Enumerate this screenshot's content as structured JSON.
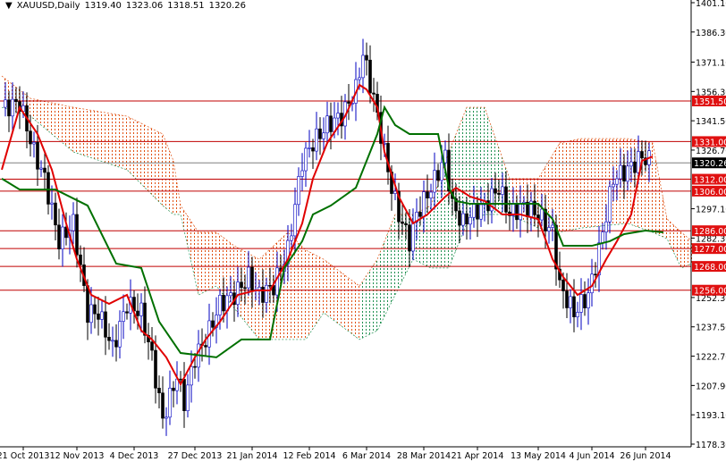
{
  "title": {
    "symbol": "XAUUSD,Daily",
    "open": "1319.40",
    "high": "1323.06",
    "low": "1318.51",
    "close": "1320.26"
  },
  "colors": {
    "bull": "#0000c0",
    "bear": "#000000",
    "tenkan": "#e00000",
    "kijun": "#007000",
    "cloud_bear": "#e05010",
    "cloud_bull": "#209050",
    "level": "#c00000",
    "current": "#808080"
  },
  "chart_data": {
    "type": "line",
    "title": "XAUUSD,Daily",
    "ylim": [
      1178.3,
      1401.1
    ],
    "y_ticks": [
      "1401.10",
      "1386.30",
      "1371.10",
      "1356.30",
      "1341.50",
      "1326.70",
      "1297.10",
      "1282.30",
      "1252.30",
      "1237.50",
      "1222.70",
      "1207.90",
      "1193.10",
      "1178.30"
    ],
    "x_ticks": [
      {
        "bar": 6,
        "label": "21 Oct 2013"
      },
      {
        "bar": 21,
        "label": "12 Nov 2013"
      },
      {
        "bar": 37,
        "label": "4 Dec 2013"
      },
      {
        "bar": 54,
        "label": "27 Dec 2013"
      },
      {
        "bar": 70,
        "label": "21 Jan 2014"
      },
      {
        "bar": 86,
        "label": "12 Feb 2014"
      },
      {
        "bar": 102,
        "label": "6 Mar 2014"
      },
      {
        "bar": 118,
        "label": "28 Mar 2014"
      },
      {
        "bar": 133,
        "label": "21 Apr 2014"
      },
      {
        "bar": 150,
        "label": "13 May 2014"
      },
      {
        "bar": 165,
        "label": "4 Jun 2014"
      },
      {
        "bar": 180,
        "label": "26 Jun 2014"
      }
    ],
    "levels": [
      "1351.50",
      "1331.00",
      "1312.00",
      "1306.00",
      "1286.00",
      "1277.00",
      "1268.00",
      "1256.00"
    ],
    "current_price": "1320.26",
    "closes": [
      [
        1,
        1348.3
      ],
      [
        5,
        1350.6
      ],
      [
        9,
        1325.8
      ],
      [
        12,
        1312.3
      ],
      [
        16,
        1280.7
      ],
      [
        20,
        1289.7
      ],
      [
        24,
        1244.6
      ],
      [
        27,
        1244.6
      ],
      [
        31,
        1226.6
      ],
      [
        35,
        1249.1
      ],
      [
        39,
        1244.6
      ],
      [
        42,
        1222.1
      ],
      [
        45,
        1190.5
      ],
      [
        49,
        1213.1
      ],
      [
        51,
        1199.5
      ],
      [
        54,
        1222.1
      ],
      [
        57,
        1231.1
      ],
      [
        61,
        1249.1
      ],
      [
        65,
        1253.6
      ],
      [
        69,
        1262.6
      ],
      [
        72,
        1253.6
      ],
      [
        76,
        1258.1
      ],
      [
        80,
        1276.2
      ],
      [
        84,
        1321.3
      ],
      [
        87,
        1330.3
      ],
      [
        91,
        1339.3
      ],
      [
        95,
        1343.8
      ],
      [
        99,
        1357.3
      ],
      [
        101,
        1375.4
      ],
      [
        104,
        1352.8
      ],
      [
        106,
        1334.8
      ],
      [
        109,
        1307.7
      ],
      [
        111,
        1294.2
      ],
      [
        114,
        1280.7
      ],
      [
        116,
        1294.2
      ],
      [
        120,
        1307.7
      ],
      [
        124,
        1323.5
      ],
      [
        126,
        1298.7
      ],
      [
        129,
        1289.7
      ],
      [
        131,
        1294.2
      ],
      [
        135,
        1298.7
      ],
      [
        139,
        1307.7
      ],
      [
        142,
        1294.2
      ],
      [
        146,
        1298.7
      ],
      [
        150,
        1294.2
      ],
      [
        154,
        1285.2
      ],
      [
        156,
        1258.1
      ],
      [
        160,
        1244.6
      ],
      [
        164,
        1253.6
      ],
      [
        167,
        1276.2
      ],
      [
        171,
        1312.3
      ],
      [
        175,
        1316.8
      ],
      [
        179,
        1323.5
      ],
      [
        182,
        1320.3
      ]
    ],
    "series": [
      {
        "name": "Tenkan-sen",
        "values": [
          [
            0,
            1316.8
          ],
          [
            5,
            1348.3
          ],
          [
            10,
            1334.8
          ],
          [
            14,
            1316.8
          ],
          [
            18,
            1289.7
          ],
          [
            21,
            1271.6
          ],
          [
            25,
            1253.6
          ],
          [
            30,
            1249.1
          ],
          [
            35,
            1253.6
          ],
          [
            39,
            1235.6
          ],
          [
            42,
            1231.1
          ],
          [
            46,
            1222.1
          ],
          [
            50,
            1208.5
          ],
          [
            54,
            1222.1
          ],
          [
            57,
            1231.1
          ],
          [
            61,
            1240.1
          ],
          [
            66,
            1253.6
          ],
          [
            71,
            1255.9
          ],
          [
            75,
            1255.9
          ],
          [
            80,
            1271.6
          ],
          [
            84,
            1289.7
          ],
          [
            87,
            1312.3
          ],
          [
            91,
            1330.3
          ],
          [
            96,
            1343.8
          ],
          [
            100,
            1359.6
          ],
          [
            102,
            1357.3
          ],
          [
            105,
            1348.3
          ],
          [
            107,
            1325.8
          ],
          [
            111,
            1303.2
          ],
          [
            115,
            1289.7
          ],
          [
            119,
            1294.2
          ],
          [
            124,
            1303.2
          ],
          [
            127,
            1307.7
          ],
          [
            131,
            1303.2
          ],
          [
            135,
            1301.0
          ],
          [
            140,
            1294.2
          ],
          [
            145,
            1294.2
          ],
          [
            150,
            1291.9
          ],
          [
            154,
            1271.6
          ],
          [
            157,
            1262.6
          ],
          [
            161,
            1253.6
          ],
          [
            165,
            1258.1
          ],
          [
            169,
            1271.6
          ],
          [
            172,
            1280.7
          ],
          [
            176,
            1294.2
          ],
          [
            179,
            1321.3
          ],
          [
            182,
            1323.5
          ]
        ]
      },
      {
        "name": "Kijun-sen",
        "values": [
          [
            0,
            1312.3
          ],
          [
            5,
            1306.8
          ],
          [
            15,
            1306.8
          ],
          [
            24,
            1298.7
          ],
          [
            32,
            1269.4
          ],
          [
            39,
            1267.2
          ],
          [
            44,
            1240.1
          ],
          [
            50,
            1224.3
          ],
          [
            60,
            1222.1
          ],
          [
            67,
            1231.1
          ],
          [
            75,
            1231.1
          ],
          [
            79,
            1267.2
          ],
          [
            84,
            1280.7
          ],
          [
            87,
            1294.2
          ],
          [
            92,
            1298.7
          ],
          [
            99,
            1307.7
          ],
          [
            105,
            1334.8
          ],
          [
            107,
            1348.3
          ],
          [
            110,
            1339.3
          ],
          [
            114,
            1334.8
          ],
          [
            122,
            1334.8
          ],
          [
            125,
            1307.7
          ],
          [
            127,
            1301.0
          ],
          [
            131,
            1299.6
          ],
          [
            150,
            1299.6
          ],
          [
            154,
            1291.9
          ],
          [
            157,
            1278.4
          ],
          [
            165,
            1278.4
          ],
          [
            170,
            1280.7
          ],
          [
            174,
            1284.3
          ],
          [
            180,
            1286.1
          ],
          [
            185,
            1285.2
          ]
        ]
      }
    ],
    "cloud": [
      [
        0,
        1364.1,
        1348.3,
        "bear"
      ],
      [
        8,
        1352.8,
        1343.8,
        "bear"
      ],
      [
        20,
        1348.3,
        1325.8,
        "bear"
      ],
      [
        35,
        1343.8,
        1316.8,
        "bear"
      ],
      [
        45,
        1334.8,
        1298.7,
        "bear"
      ],
      [
        48,
        1321.3,
        1294.2,
        "bear"
      ],
      [
        50,
        1298.7,
        1294.2,
        "bear"
      ],
      [
        55,
        1285.2,
        1253.6,
        "bear"
      ],
      [
        60,
        1285.2,
        1258.1,
        "bear"
      ],
      [
        65,
        1278.4,
        1246.9,
        "bear"
      ],
      [
        72,
        1271.6,
        1231.1,
        "bear"
      ],
      [
        80,
        1285.2,
        1231.1,
        "bear"
      ],
      [
        85,
        1276.2,
        1231.1,
        "bear"
      ],
      [
        90,
        1271.6,
        1244.6,
        "bear"
      ],
      [
        100,
        1258.1,
        1231.1,
        "bull"
      ],
      [
        105,
        1271.6,
        1235.6,
        "bull"
      ],
      [
        110,
        1294.2,
        1253.6,
        "bull"
      ],
      [
        115,
        1294.2,
        1271.6,
        "bull"
      ],
      [
        120,
        1298.7,
        1267.2,
        "bull"
      ],
      [
        125,
        1325.8,
        1267.2,
        "bull"
      ],
      [
        130,
        1348.3,
        1289.7,
        "bull"
      ],
      [
        135,
        1348.3,
        1294.2,
        "bull"
      ],
      [
        142,
        1312.3,
        1294.2,
        "bear"
      ],
      [
        150,
        1312.3,
        1287.4,
        "bear"
      ],
      [
        156,
        1330.3,
        1285.2,
        "bear"
      ],
      [
        162,
        1332.5,
        1287.4,
        "bear"
      ],
      [
        175,
        1332.5,
        1289.7,
        "bear"
      ],
      [
        182,
        1330.3,
        1285.2,
        "bear"
      ],
      [
        186,
        1292.0,
        1282.0,
        "bear"
      ],
      [
        190,
        1285.2,
        1267.2,
        "bear"
      ],
      [
        193,
        1280.7,
        1269.4,
        "bear"
      ]
    ]
  }
}
